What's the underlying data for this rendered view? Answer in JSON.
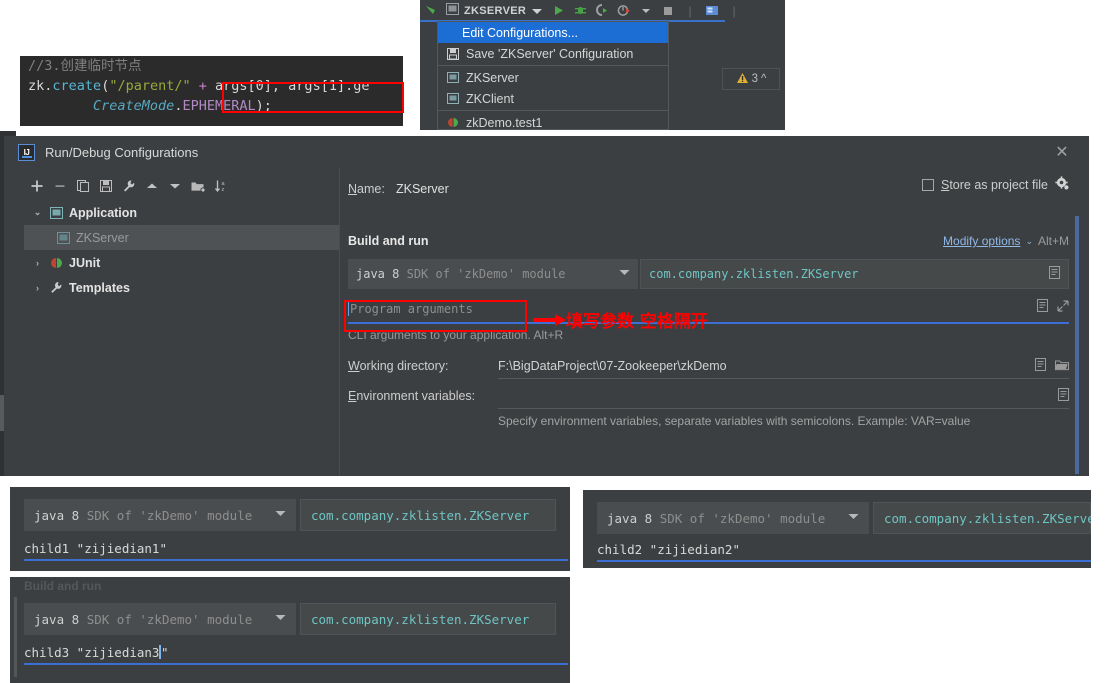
{
  "code_snippet": {
    "line1_comment": "//3.创建临时节点",
    "line2": {
      "obj": "zk",
      "dot": ".",
      "method": "create",
      "open": "(",
      "string": "\"/parent/\"",
      "plus": "+",
      "args": "args[0], args[1].ge"
    },
    "line3": {
      "class": "CreateMode",
      "dot": ".",
      "constant": "EPHEMERAL",
      "tail": ");"
    }
  },
  "ide_toolbar": {
    "config_name": "ZKSERVER",
    "icons": [
      "back-arrow-icon",
      "application-config-icon",
      "chevron-down-icon",
      "run-icon",
      "debug-icon",
      "run-with-coverage-icon",
      "profiler-icon",
      "profiler-dropdown-icon",
      "stop-icon",
      "services-icon"
    ],
    "warning_badge": {
      "icon": "warning-triangle-icon",
      "count": "3",
      "collapse": "^"
    }
  },
  "run_menu": {
    "items": [
      {
        "label": "Edit Configurations...",
        "icon": "none",
        "selected": true
      },
      {
        "label": "Save 'ZKServer' Configuration",
        "icon": "save-icon",
        "selected": false
      },
      {
        "label": "ZKServer",
        "icon": "application-config-icon",
        "selected": false
      },
      {
        "label": "ZKClient",
        "icon": "application-config-icon",
        "selected": false
      },
      {
        "label": "zkDemo.test1",
        "icon": "junit-icon",
        "selected": false
      }
    ]
  },
  "dialog": {
    "title": "Run/Debug Configurations",
    "logo": "intellij-idea-logo",
    "close": "✕",
    "toolbar_icons": [
      "add-icon",
      "remove-icon",
      "copy-configuration-icon",
      "save-configuration-icon",
      "edit-templates-icon",
      "move-up-icon",
      "move-down-icon",
      "move-into-new-folder-icon",
      "sort-configurations-icon"
    ],
    "toolbar_glyphs": [
      "+",
      "−",
      "❐",
      "🖫",
      "🔧",
      "▲",
      "▼",
      "📁",
      "↓ᶻ"
    ],
    "tree": [
      {
        "label": "Application",
        "twisty": "⌄",
        "icon": "application-config-icon",
        "level": 0,
        "selected": false
      },
      {
        "label": "ZKServer",
        "twisty": "",
        "icon": "application-config-icon",
        "level": 1,
        "selected": true
      },
      {
        "label": "JUnit",
        "twisty": "›",
        "icon": "junit-icon",
        "level": 0,
        "selected": false
      },
      {
        "label": "Templates",
        "twisty": "›",
        "icon": "wrench-icon",
        "level": 0,
        "selected": false
      }
    ],
    "form": {
      "name_label": "Name:",
      "name_label_mnemonic": "N",
      "name_value": "ZKServer",
      "store_as_project_file": "Store as project file",
      "store_mnemonic": "S",
      "store_checked": false,
      "gear_icon": "gear-icon",
      "build_and_run": "Build and run",
      "modify_options": "Modify options",
      "modify_mnemonic": "M",
      "modify_caret": "⌄",
      "modify_shortcut": "Alt+M",
      "sdk_prefix": "java 8",
      "sdk_suffix": "SDK of 'zkDemo' module",
      "sdk_caret": "▼",
      "main_class": "com.company.zklisten.ZKServer",
      "main_class_trail_icon": "expand-editor-icon",
      "program_arguments_placeholder": "Program arguments",
      "program_arguments_value": "",
      "program_arguments_trail_icons": [
        "insert-macro-icon",
        "expand-icon"
      ],
      "cli_hint": "CLI arguments to your application. Alt+R",
      "working_directory_label": "Working directory:",
      "working_directory_mnemonic": "W",
      "working_directory_value": "F:\\BigDataProject\\07-Zookeeper\\zkDemo",
      "working_directory_trail_icons": [
        "insert-macro-icon",
        "browse-folder-icon"
      ],
      "environment_variables_label": "Environment variables:",
      "environment_variables_mnemonic": "E",
      "environment_variables_value": "",
      "environment_variables_trail_icon": "insert-macro-icon",
      "environment_variables_hint": "Specify environment variables, separate variables with semicolons. Example: VAR=value"
    }
  },
  "annotation": {
    "arrow": "➜",
    "text": "填写参数 空格隔开",
    "color": "#ff0000"
  },
  "panels": [
    {
      "sdk_prefix": "java 8",
      "sdk_suffix": "SDK of 'zkDemo' module",
      "sdk_caret": "▼",
      "main_class": "com.company.zklisten.ZKServer",
      "arguments": "child1 \"zijiedian1\""
    },
    {
      "sdk_prefix": "java 8",
      "sdk_suffix": "SDK of 'zkDemo' module",
      "sdk_caret": "▼",
      "main_class": "com.company.zklisten.ZKServer",
      "arguments": "child2 \"zijiedian2\""
    },
    {
      "ghost_header": "Build and run",
      "sdk_prefix": "java 8",
      "sdk_suffix": "SDK of 'zkDemo' module",
      "sdk_caret": "▼",
      "main_class": "com.company.zklisten.ZKServer",
      "arguments_before_caret": "child3 \"zijiedian3",
      "arguments_after_caret": "\""
    }
  ],
  "colors": {
    "dialog_bg": "#3c3f41",
    "editor_bg": "#2b2b2b",
    "accent_blue": "#3b6fd4",
    "selection_blue": "#1d6ed4",
    "annotation_red": "#ff0000",
    "teal_text": "#6fc4c4"
  }
}
